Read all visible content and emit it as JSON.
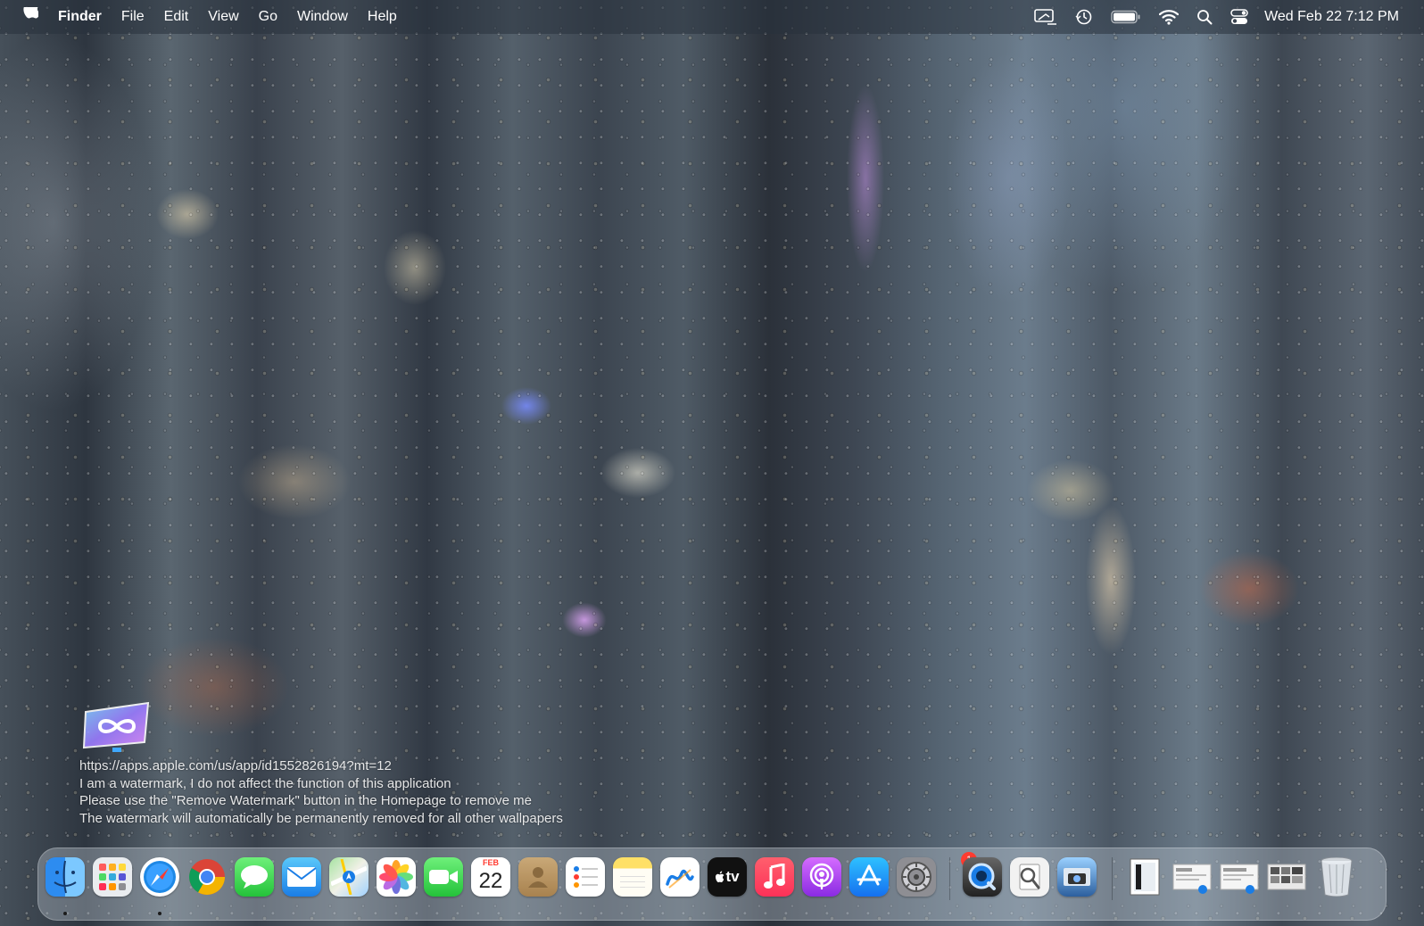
{
  "menubar": {
    "app_name": "Finder",
    "menus": [
      "File",
      "Edit",
      "View",
      "Go",
      "Window",
      "Help"
    ],
    "status_icons": [
      "screen-mirroring-icon",
      "time-machine-icon",
      "battery-icon",
      "wifi-icon",
      "spotlight-search-icon",
      "control-center-icon"
    ],
    "clock": "Wed Feb 22  7:12 PM"
  },
  "watermark": {
    "lines": [
      "https://apps.apple.com/us/app/id1552826194?mt=12",
      "I am a watermark, I do not affect the function of this application",
      "Please use the \"Remove Watermark\" button in the Homepage to remove me",
      "The watermark will automatically be permanently removed for all other wallpapers"
    ]
  },
  "dock": {
    "apps": [
      "Finder",
      "Launchpad",
      "Safari",
      "Google Chrome",
      "Messages",
      "Mail",
      "Maps",
      "Photos",
      "FaceTime",
      "Calendar",
      "Contacts",
      "Reminders",
      "Notes",
      "Freeform",
      "Apple TV",
      "Music",
      "Podcasts",
      "App Store",
      "System Settings",
      "QuickTime Player",
      "Preview",
      "Screenshot",
      "Document",
      "Screenshot 1",
      "Screenshot 2",
      "Screenshot 3",
      "Trash"
    ],
    "calendar_month": "FEB",
    "calendar_day": "22",
    "appletv_label": "tv",
    "settings_badge": "1"
  }
}
